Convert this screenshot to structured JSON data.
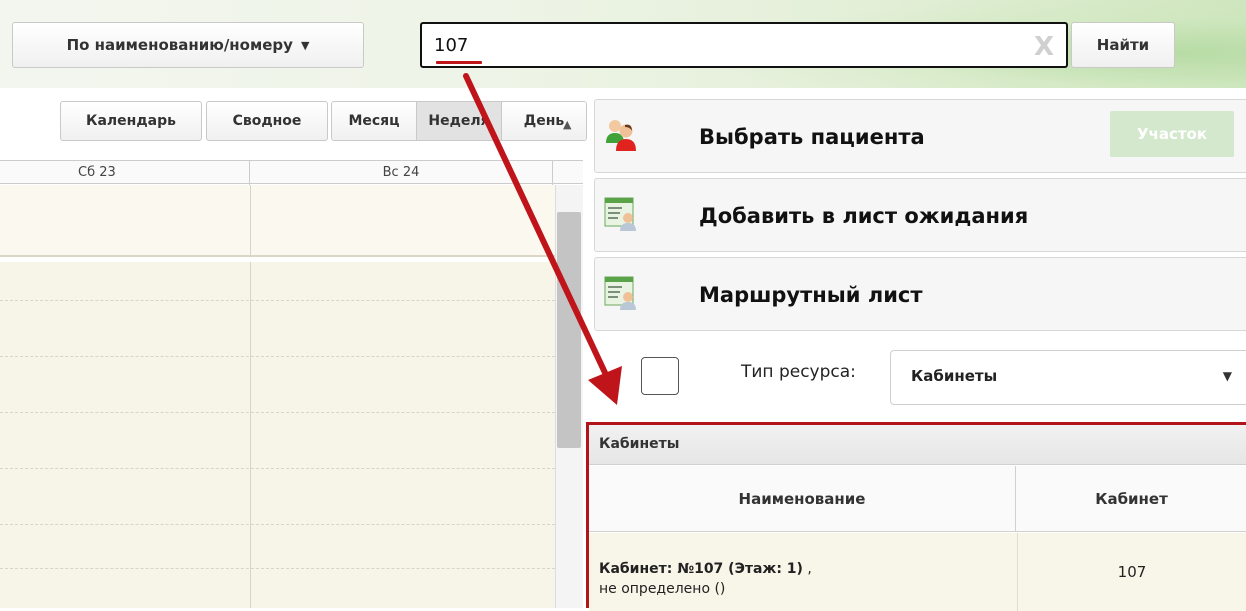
{
  "search": {
    "mode_label": "По наименованию/номеру",
    "mode_caret": "▼",
    "query": "107",
    "clear_icon": "X",
    "find_label": "Найти"
  },
  "view_tabs": {
    "calendar": "Календарь",
    "summary": "Сводное",
    "month": "Месяц",
    "week": "Неделя",
    "day": "День",
    "active": "week"
  },
  "calendar": {
    "days": [
      "Сб 23",
      "Вс 24"
    ]
  },
  "actions": {
    "select_patient": "Выбрать пациента",
    "uchastok": "Участок",
    "add_waitlist": "Добавить в лист ожидания",
    "route_sheet": "Маршрутный лист"
  },
  "resource": {
    "type_label": "Тип ресурса:",
    "type_value": "Кабинеты",
    "caret": "▼"
  },
  "grid": {
    "title": "Кабинеты",
    "columns": [
      "Наименование",
      "Кабинет"
    ],
    "rows": [
      {
        "name_bold": "Кабинет: №107 (Этаж: 1)",
        "name_suffix": " ,",
        "name_line2": "не определено ()",
        "cabinet": "107"
      }
    ]
  },
  "colors": {
    "highlight_red": "#b3141b",
    "accent_green": "#d3e8cc"
  },
  "icons": {
    "patient": "patients-icon",
    "waitlist": "list-card-icon",
    "route": "list-card-icon"
  }
}
